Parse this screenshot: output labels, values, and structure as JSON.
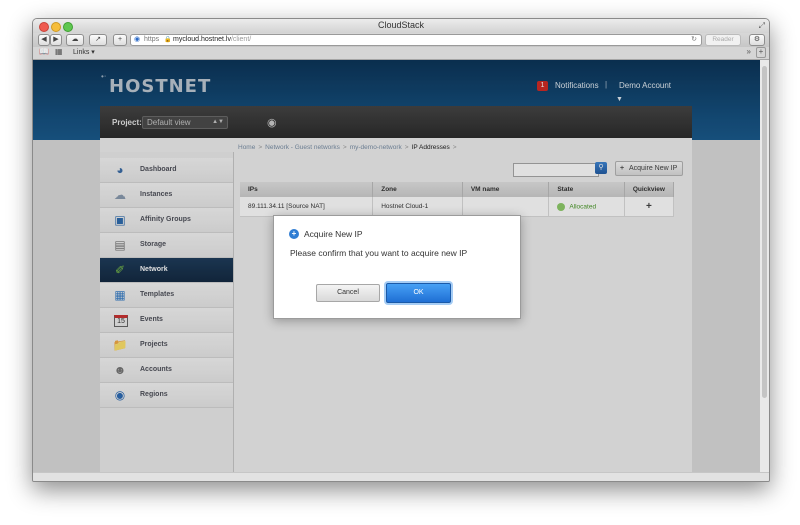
{
  "window": {
    "title": "CloudStack",
    "url_protocol": "https",
    "url_host": "mycloud.hostnet.lv",
    "url_path": "/client/",
    "reader_label": "Reader",
    "bookmarks_label": "Links ▾"
  },
  "header": {
    "logo": "HOSTNET",
    "notification_count": "1",
    "notifications_label": "Notifications",
    "separator": "|",
    "account_label": "Demo Account"
  },
  "project": {
    "label": "Project:",
    "selected": "Default view"
  },
  "sidebar": {
    "items": [
      {
        "label": "Dashboard",
        "icon": "dashboard-icon"
      },
      {
        "label": "Instances",
        "icon": "cloud-icon"
      },
      {
        "label": "Affinity Groups",
        "icon": "affinity-icon"
      },
      {
        "label": "Storage",
        "icon": "storage-icon"
      },
      {
        "label": "Network",
        "icon": "network-icon"
      },
      {
        "label": "Templates",
        "icon": "templates-icon"
      },
      {
        "label": "Events",
        "icon": "calendar-icon"
      },
      {
        "label": "Projects",
        "icon": "folder-icon"
      },
      {
        "label": "Accounts",
        "icon": "user-icon"
      },
      {
        "label": "Regions",
        "icon": "globe-icon"
      }
    ],
    "events_day": "15"
  },
  "breadcrumb": {
    "items": [
      "Home",
      "Network - Guest networks",
      "my-demo-network",
      "IP Addresses"
    ],
    "separator": ">"
  },
  "toolbar": {
    "search_value": "",
    "acquire_label": "Acquire New IP"
  },
  "table": {
    "columns": [
      "IPs",
      "Zone",
      "VM name",
      "State",
      "Quickview"
    ],
    "rows": [
      {
        "ip": "89.111.34.11 [Source NAT]",
        "zone": "Hostnet Cloud-1",
        "vm": "",
        "state": "Allocated"
      }
    ]
  },
  "dialog": {
    "title": "Acquire New IP",
    "message": "Please confirm that you want to acquire new IP",
    "cancel_label": "Cancel",
    "ok_label": "OK"
  }
}
